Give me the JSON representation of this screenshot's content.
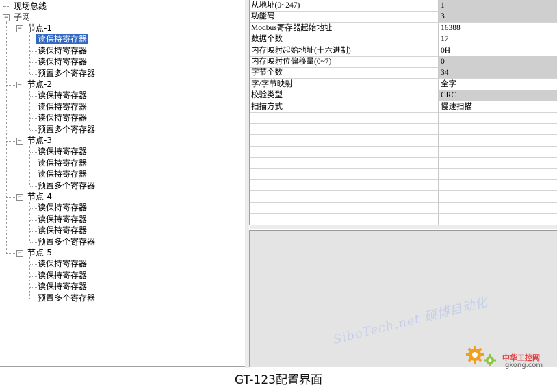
{
  "tree": {
    "root": "现场总线",
    "subnet": "子网",
    "nodes": [
      {
        "label": "节点-1",
        "items": [
          "读保持寄存器",
          "读保持寄存器",
          "读保持寄存器",
          "预置多个寄存器"
        ]
      },
      {
        "label": "节点-2",
        "items": [
          "读保持寄存器",
          "读保持寄存器",
          "读保持寄存器",
          "预置多个寄存器"
        ]
      },
      {
        "label": "节点-3",
        "items": [
          "读保持寄存器",
          "读保持寄存器",
          "读保持寄存器",
          "预置多个寄存器"
        ]
      },
      {
        "label": "节点-4",
        "items": [
          "读保持寄存器",
          "读保持寄存器",
          "读保持寄存器",
          "预置多个寄存器"
        ]
      },
      {
        "label": "节点-5",
        "items": [
          "读保持寄存器",
          "读保持寄存器",
          "读保持寄存器",
          "预置多个寄存器"
        ]
      }
    ],
    "expander_open": "−"
  },
  "properties": [
    {
      "name": "从地址(0~247)",
      "value": "1"
    },
    {
      "name": "功能码",
      "value": "3"
    },
    {
      "name": "Modbus寄存器起始地址",
      "value": "16388"
    },
    {
      "name": "数据个数",
      "value": "17"
    },
    {
      "name": "内存映射起始地址(十六进制)",
      "value": "0H"
    },
    {
      "name": "内存映射位偏移量(0~7)",
      "value": "0"
    },
    {
      "name": "字节个数",
      "value": "34"
    },
    {
      "name": "字/字节映射",
      "value": "全字"
    },
    {
      "name": "校验类型",
      "value": "CRC"
    },
    {
      "name": "扫描方式",
      "value": "慢速扫描"
    }
  ],
  "watermark": {
    "text": "SiboTech.net 硕博自动化",
    "logo_cn": "中华工控网",
    "logo_en": "gkong.com"
  },
  "caption": "GT-123配置界面",
  "colors": {
    "selection": "#3168c4",
    "shaded_value": "#cfcfcf",
    "desc_panel": "#e4e4e4"
  }
}
